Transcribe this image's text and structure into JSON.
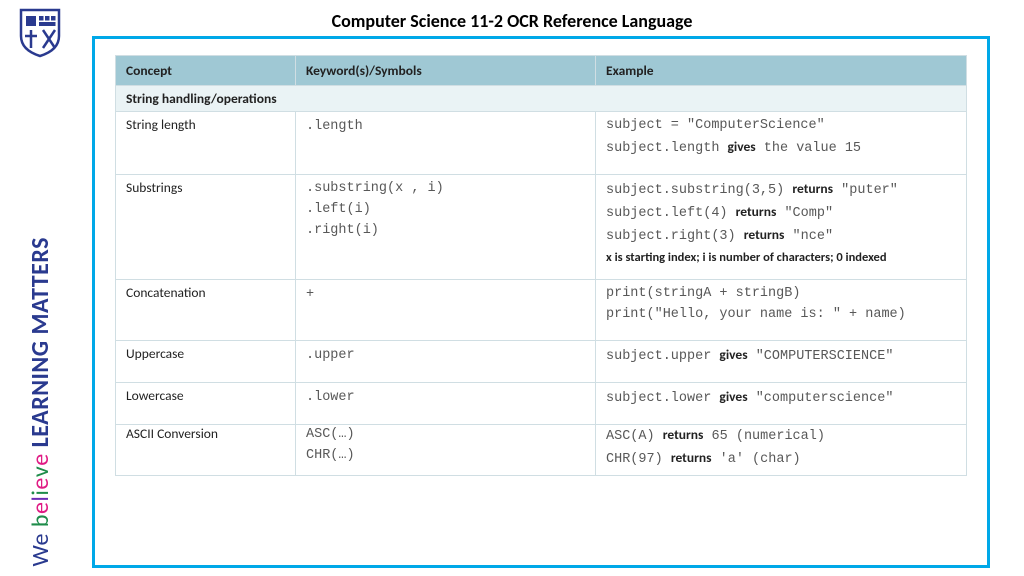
{
  "title": "Computer Science 11-2 OCR Reference Language",
  "motto": {
    "we": "We ",
    "b": "b",
    "e1": "e",
    "l": "l",
    "i": "i",
    "e2": "e",
    "v": "v",
    "e3": "e",
    "learn": " LEARNING MATTERS"
  },
  "table": {
    "headers": {
      "concept": "Concept",
      "keywords": "Keyword(s)/Symbols",
      "example": "Example"
    },
    "section": "String handling/operations",
    "rows": {
      "length": {
        "concept": "String length",
        "keyword": ".length",
        "ex1": "subject = \"ComputerScience\"",
        "ex2a": "subject.length ",
        "ex2b": "gives",
        "ex2c": " the value 15"
      },
      "substr": {
        "concept": "Substrings",
        "k1": ".substring(x , i)",
        "k2": ".left(i)",
        "k3": ".right(i)",
        "e1a": "subject.substring(3,5) ",
        "e1b": "returns",
        "e1c": " \"puter\"",
        "e2a": "subject.left(4) ",
        "e2b": "returns",
        "e2c": " \"Comp\"",
        "e3a": "subject.right(3) ",
        "e3b": "returns",
        "e3c": " \"nce\"",
        "note": "x is starting index; i is number of characters; 0 indexed"
      },
      "concat": {
        "concept": "Concatenation",
        "keyword": "+",
        "e1": "print(stringA + stringB)",
        "e2": "print(\"Hello, your name is: \" + name)"
      },
      "upper": {
        "concept": "Uppercase",
        "keyword": ".upper",
        "ea": "subject.upper ",
        "eb": "gives",
        "ec": " \"COMPUTERSCIENCE\""
      },
      "lower": {
        "concept": "Lowercase",
        "keyword": ".lower",
        "ea": "subject.lower ",
        "eb": "gives",
        "ec": " \"computerscience\""
      },
      "ascii": {
        "concept": "ASCII Conversion",
        "k1": "ASC(…)",
        "k2": "CHR(…)",
        "e1a": "ASC(A) ",
        "e1b": "returns",
        "e1c": " 65 (numerical)",
        "e2a": "CHR(97) ",
        "e2b": "returns",
        "e2c": " 'a' (char)"
      }
    }
  }
}
